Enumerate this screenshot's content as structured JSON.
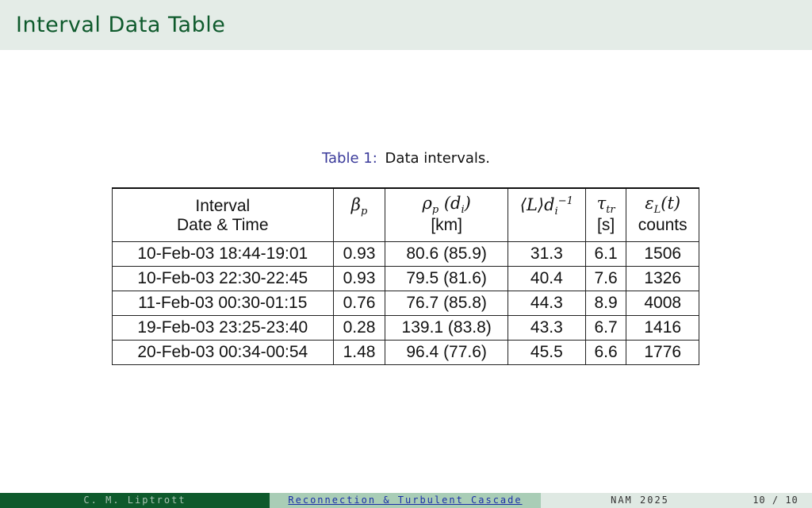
{
  "header": {
    "title": "Interval Data Table"
  },
  "caption": {
    "label": "Table 1:",
    "text": "Data intervals."
  },
  "table": {
    "col1_head": [
      "Interval",
      "Date & Time"
    ],
    "col_beta": {
      "sym": "β",
      "sub": "p"
    },
    "col_rho": {
      "sym": "ρ",
      "sub": "p",
      "paren": "(d",
      "paren_sub": "i",
      "close": ")",
      "unit": "[km]"
    },
    "col_L": {
      "text": "⟨L⟩d",
      "sub": "i",
      "sup": "−1"
    },
    "col_tau": {
      "sym": "τ",
      "sub": "tr",
      "unit": "[s]"
    },
    "col_eps": {
      "sym": "ε",
      "sub": "L",
      "arg": "(t)",
      "unit": "counts"
    },
    "rows": [
      [
        "10-Feb-03  18:44-19:01",
        "0.93",
        "80.6 (85.9)",
        "31.3",
        "6.1",
        "1506"
      ],
      [
        "10-Feb-03  22:30-22:45",
        "0.93",
        "79.5 (81.6)",
        "40.4",
        "7.6",
        "1326"
      ],
      [
        "11-Feb-03  00:30-01:15",
        "0.76",
        "76.7 (85.8)",
        "44.3",
        "8.9",
        "4008"
      ],
      [
        "19-Feb-03  23:25-23:40",
        "0.28",
        "139.1 (83.8)",
        "43.3",
        "6.7",
        "1416"
      ],
      [
        "20-Feb-03  00:34-00:54",
        "1.48",
        "96.4 (77.6)",
        "45.5",
        "6.6",
        "1776"
      ]
    ]
  },
  "footer": {
    "author": "C. M. Liptrott",
    "talk": "Reconnection & Turbulent Cascade",
    "conference": "NAM 2025",
    "page": "10 / 10"
  }
}
